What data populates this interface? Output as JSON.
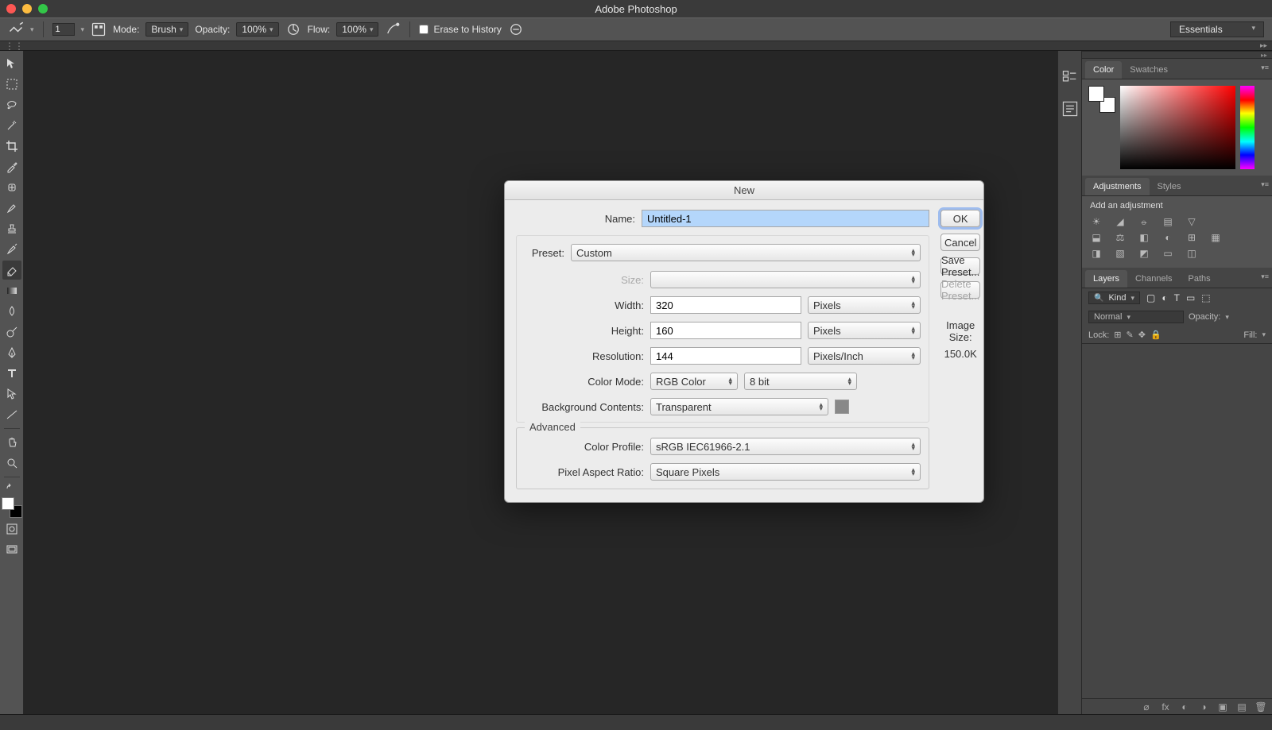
{
  "titlebar": {
    "title": "Adobe Photoshop"
  },
  "optionsbar": {
    "size_value": "1",
    "mode_label": "Mode:",
    "mode_value": "Brush",
    "opacity_label": "Opacity:",
    "opacity_value": "100%",
    "flow_label": "Flow:",
    "flow_value": "100%",
    "erase_label": "Erase to History",
    "workspace": "Essentials"
  },
  "panels": {
    "color_tab": "Color",
    "swatches_tab": "Swatches",
    "adjustments_tab": "Adjustments",
    "styles_tab": "Styles",
    "add_adjustment": "Add an adjustment",
    "layers_tab": "Layers",
    "channels_tab": "Channels",
    "paths_tab": "Paths",
    "kind_label": "Kind",
    "blend_mode": "Normal",
    "opacity_label": "Opacity:",
    "lock_label": "Lock:",
    "fill_label": "Fill:"
  },
  "dialog": {
    "title": "New",
    "name_label": "Name:",
    "name_value": "Untitled-1",
    "preset_label": "Preset:",
    "preset_value": "Custom",
    "size_label": "Size:",
    "width_label": "Width:",
    "width_value": "320",
    "width_unit": "Pixels",
    "height_label": "Height:",
    "height_value": "160",
    "height_unit": "Pixels",
    "res_label": "Resolution:",
    "res_value": "144",
    "res_unit": "Pixels/Inch",
    "colormode_label": "Color Mode:",
    "colormode_value": "RGB Color",
    "colordepth_value": "8 bit",
    "bg_label": "Background Contents:",
    "bg_value": "Transparent",
    "advanced_label": "Advanced",
    "profile_label": "Color Profile:",
    "profile_value": "sRGB IEC61966-2.1",
    "par_label": "Pixel Aspect Ratio:",
    "par_value": "Square Pixels",
    "ok": "OK",
    "cancel": "Cancel",
    "save_preset": "Save Preset...",
    "delete_preset": "Delete Preset...",
    "image_size_label": "Image Size:",
    "image_size_value": "150.0K"
  }
}
